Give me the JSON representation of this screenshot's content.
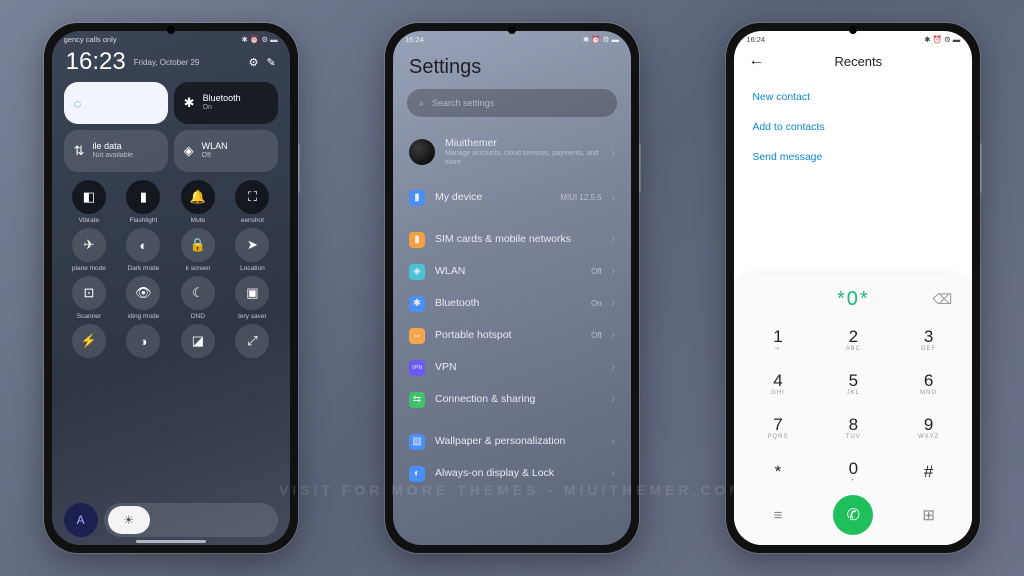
{
  "watermark": "VISIT FOR MORE THEMES - MIUITHEMER.COM",
  "p1": {
    "status_left": "gency calls only",
    "time": "16:23",
    "date": "Friday, October 29",
    "tiles": [
      {
        "icon": "◌",
        "name": "",
        "sub": ""
      },
      {
        "icon": "✱",
        "name": "Bluetooth",
        "sub": "On"
      },
      {
        "icon": "⇅",
        "name": "ile data",
        "sub": "Not available"
      },
      {
        "icon": "◈",
        "name": "WLAN",
        "sub": "Off"
      }
    ],
    "toggles": [
      {
        "icon": "◧",
        "label": "Vibrate",
        "active": true
      },
      {
        "icon": "▮",
        "label": "Flashlight",
        "active": true
      },
      {
        "icon": "🔔",
        "label": "Mute",
        "active": true
      },
      {
        "icon": "⛶",
        "label": "eenshot",
        "active": true
      },
      {
        "icon": "✈",
        "label": "plane mode",
        "active": false
      },
      {
        "icon": "◐",
        "label": "Dark mode",
        "active": false
      },
      {
        "icon": "🔒",
        "label": "k screen",
        "active": false
      },
      {
        "icon": "➤",
        "label": "Location",
        "active": false
      },
      {
        "icon": "⊡",
        "label": "Scanner",
        "active": false
      },
      {
        "icon": "👁",
        "label": "iding mode",
        "active": false
      },
      {
        "icon": "☾",
        "label": "DND",
        "active": false
      },
      {
        "icon": "▣",
        "label": "tery saver",
        "active": false
      },
      {
        "icon": "⚡",
        "label": "",
        "active": false
      },
      {
        "icon": "◑",
        "label": "",
        "active": false
      },
      {
        "icon": "◪",
        "label": "",
        "active": false
      },
      {
        "icon": "⤢",
        "label": "",
        "active": false
      }
    ],
    "auto": "A"
  },
  "p2": {
    "time": "16:24",
    "title": "Settings",
    "search_ph": "Search settings",
    "profile_name": "Miuithemer",
    "profile_sub": "Manage accounts, cloud services, payments, and more",
    "rows": [
      {
        "icon": "▮",
        "cls": "ic-blue",
        "name": "My device",
        "val": "MIUI 12.5.5"
      },
      {
        "icon": "▮",
        "cls": "ic-orange",
        "name": "SIM cards & mobile networks",
        "val": ""
      },
      {
        "icon": "◈",
        "cls": "ic-teal",
        "name": "WLAN",
        "val": "Off"
      },
      {
        "icon": "✱",
        "cls": "ic-bt",
        "name": "Bluetooth",
        "val": "On"
      },
      {
        "icon": "⇔",
        "cls": "ic-link",
        "name": "Portable hotspot",
        "val": "Off"
      },
      {
        "icon": "VPN",
        "cls": "ic-vpn",
        "name": "VPN",
        "val": ""
      },
      {
        "icon": "⇆",
        "cls": "ic-green",
        "name": "Connection & sharing",
        "val": ""
      },
      {
        "icon": "▨",
        "cls": "ic-wall",
        "name": "Wallpaper & personalization",
        "val": ""
      },
      {
        "icon": "◐",
        "cls": "ic-blue",
        "name": "Always-on display & Lock",
        "val": ""
      }
    ]
  },
  "p3": {
    "time": "16:24",
    "title": "Recents",
    "links": [
      "New contact",
      "Add to contacts",
      "Send message"
    ],
    "dialed": "*0*",
    "keys": [
      {
        "n": "1",
        "l": "∞"
      },
      {
        "n": "2",
        "l": "ABC"
      },
      {
        "n": "3",
        "l": "DEF"
      },
      {
        "n": "4",
        "l": "GHI"
      },
      {
        "n": "5",
        "l": "JKL"
      },
      {
        "n": "6",
        "l": "MNO"
      },
      {
        "n": "7",
        "l": "PQRS"
      },
      {
        "n": "8",
        "l": "TUV"
      },
      {
        "n": "9",
        "l": "WXYZ"
      },
      {
        "n": "*",
        "l": ""
      },
      {
        "n": "0",
        "l": "+"
      },
      {
        "n": "#",
        "l": ""
      }
    ]
  }
}
